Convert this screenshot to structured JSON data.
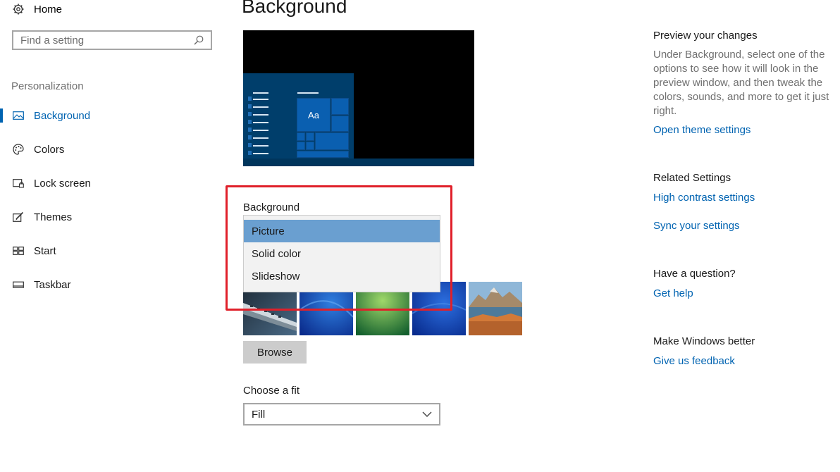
{
  "sidebar": {
    "home_label": "Home",
    "search_placeholder": "Find a setting",
    "section_label": "Personalization",
    "items": [
      {
        "label": "Background",
        "icon": "picture-icon"
      },
      {
        "label": "Colors",
        "icon": "palette-icon"
      },
      {
        "label": "Lock screen",
        "icon": "lock-screen-icon"
      },
      {
        "label": "Themes",
        "icon": "themes-icon"
      },
      {
        "label": "Start",
        "icon": "start-icon"
      },
      {
        "label": "Taskbar",
        "icon": "taskbar-icon"
      }
    ],
    "active_item": "Background"
  },
  "main": {
    "title": "Background",
    "preview_tile_label": "Aa",
    "background_label": "Background",
    "background_options": [
      "Picture",
      "Solid color",
      "Slideshow"
    ],
    "background_selected": "Picture",
    "browse_label": "Browse",
    "fit_label": "Choose a fit",
    "fit_value": "Fill"
  },
  "right_panel": {
    "preview_heading": "Preview your changes",
    "preview_text": "Under Background, select one of the options to see how it will look in the preview window, and then tweak the colors, sounds, and more to get it just right.",
    "theme_link": "Open theme settings",
    "related_heading": "Related Settings",
    "high_contrast_link": "High contrast settings",
    "sync_link": "Sync your settings",
    "question_heading": "Have a question?",
    "help_link": "Get help",
    "better_heading": "Make Windows better",
    "feedback_link": "Give us feedback"
  },
  "colors": {
    "accent": "#0063b1",
    "selected_option": "#6a9fd0",
    "highlight_box": "#e0202a"
  }
}
